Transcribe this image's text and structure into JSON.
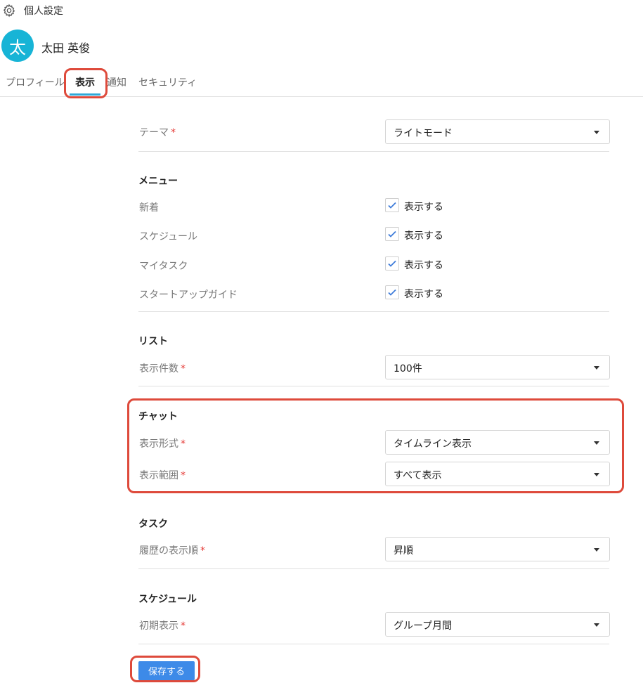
{
  "header": {
    "title": "個人設定",
    "icon": "gear-icon"
  },
  "user": {
    "avatar_initial": "太",
    "name": "太田 英俊",
    "avatar_color": "#17b4d6"
  },
  "tabs": [
    {
      "label": "プロフィール",
      "active": false
    },
    {
      "label": "表示",
      "active": true
    },
    {
      "label": "通知",
      "active": false
    },
    {
      "label": "セキュリティ",
      "active": false
    }
  ],
  "required_mark": "*",
  "theme": {
    "label": "テーマ",
    "value": "ライトモード"
  },
  "menu": {
    "title": "メニュー",
    "items": [
      {
        "label": "新着",
        "option": "表示する",
        "checked": true
      },
      {
        "label": "スケジュール",
        "option": "表示する",
        "checked": true
      },
      {
        "label": "マイタスク",
        "option": "表示する",
        "checked": true
      },
      {
        "label": "スタートアップガイド",
        "option": "表示する",
        "checked": true
      }
    ]
  },
  "list": {
    "title": "リスト",
    "count_label": "表示件数",
    "count_value": "100件"
  },
  "chat": {
    "title": "チャット",
    "format_label": "表示形式",
    "format_value": "タイムライン表示",
    "range_label": "表示範囲",
    "range_value": "すべて表示"
  },
  "task": {
    "title": "タスク",
    "order_label": "履歴の表示順",
    "order_value": "昇順"
  },
  "schedule": {
    "title": "スケジュール",
    "initial_label": "初期表示",
    "initial_value": "グループ月間"
  },
  "save_button": "保存する",
  "colors": {
    "accent": "#2ea8d8",
    "button": "#3d8ae8",
    "highlight": "#de4a3b",
    "required": "#e53935",
    "check": "#3d7bd9"
  }
}
